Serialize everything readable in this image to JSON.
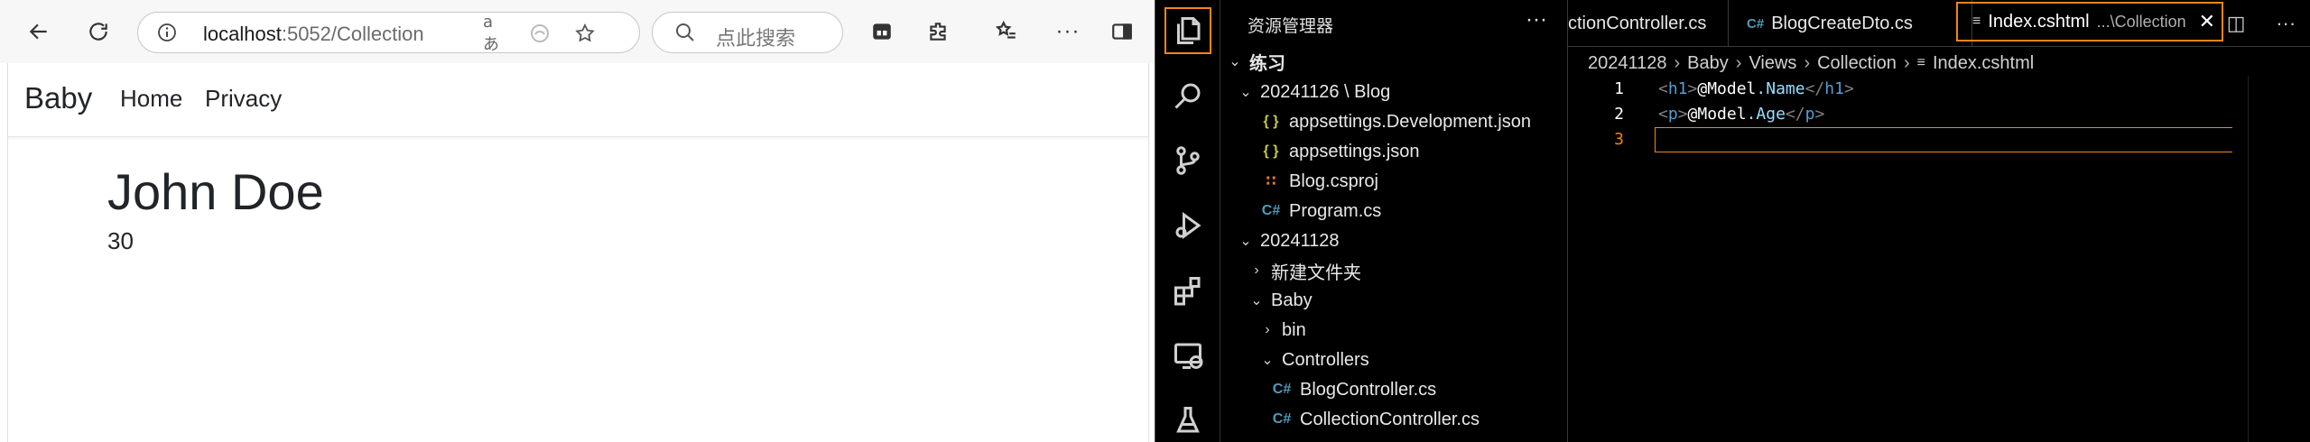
{
  "browser": {
    "address": {
      "host": "localhost",
      "path": ":5052/Collection"
    },
    "search_placeholder": "点此搜索",
    "read_aloud_label": "aあ",
    "page": {
      "brand": "Baby",
      "nav": [
        "Home",
        "Privacy"
      ],
      "model_name": "John Doe",
      "model_age": "30"
    }
  },
  "vscode": {
    "sidebar_title": "资源管理器",
    "workspace": "练习",
    "tree": [
      {
        "label": "20241126 \\ Blog",
        "type": "folder-open",
        "indent": 0
      },
      {
        "label": "appsettings.Development.json",
        "type": "json",
        "indent": 2
      },
      {
        "label": "appsettings.json",
        "type": "json",
        "indent": 2
      },
      {
        "label": "Blog.csproj",
        "type": "rss",
        "indent": 2
      },
      {
        "label": "Program.cs",
        "type": "cs",
        "indent": 2
      },
      {
        "label": "20241128",
        "type": "folder-open",
        "indent": 0
      },
      {
        "label": "新建文件夹",
        "type": "folder-closed",
        "indent": 1
      },
      {
        "label": "Baby",
        "type": "folder-open",
        "indent": 1
      },
      {
        "label": "bin",
        "type": "folder-closed",
        "indent": 2
      },
      {
        "label": "Controllers",
        "type": "folder-open",
        "indent": 2
      },
      {
        "label": "BlogController.cs",
        "type": "cs",
        "indent": 3
      },
      {
        "label": "CollectionController.cs",
        "type": "cs",
        "indent": 3
      }
    ],
    "tabs": [
      {
        "label": "ctionController.cs",
        "active": false
      },
      {
        "label": "BlogCreateDto.cs",
        "active": false
      },
      {
        "label": "Index.cshtml",
        "desc": "...\\Collection",
        "active": true
      }
    ],
    "breadcrumb": [
      "20241128",
      "Baby",
      "Views",
      "Collection",
      "Index.cshtml"
    ],
    "code_lines": [
      {
        "num": "1",
        "open": "h1",
        "model": "@Model",
        "member": ".Name"
      },
      {
        "num": "2",
        "open": "p",
        "model": "@Model",
        "member": ".Age"
      },
      {
        "num": "3"
      }
    ],
    "colors": {
      "accent": "#f38518",
      "background": "#000000",
      "cs_icon": "#519aba",
      "json_icon": "#cbcb41"
    }
  }
}
